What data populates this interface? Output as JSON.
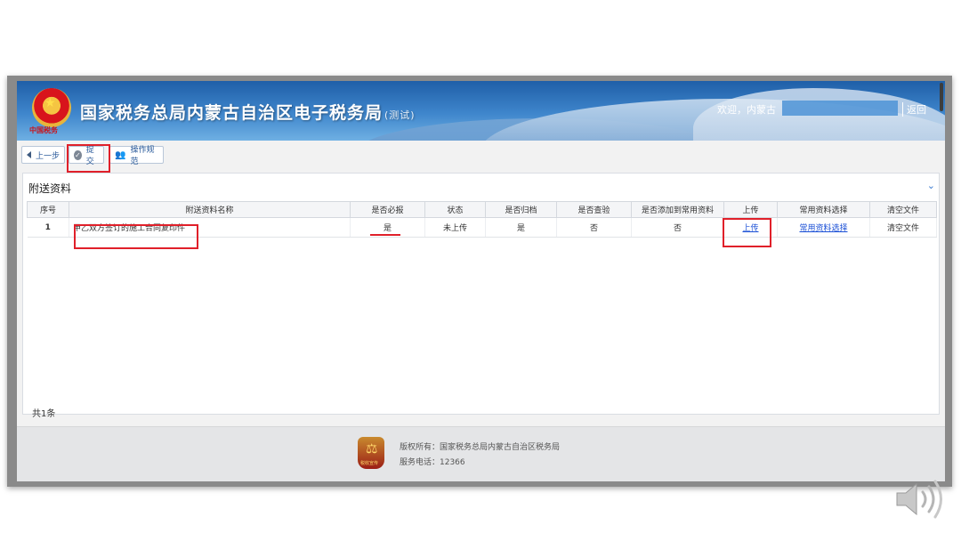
{
  "header": {
    "emblem_text": "中国税务",
    "title": "国家税务总局内蒙古自治区电子税务局",
    "title_suffix": "(测试)",
    "welcome": "欢迎，内蒙古",
    "back": "返回"
  },
  "toolbar": {
    "prev": "上一步",
    "submit": "提交",
    "rules": "操作规范"
  },
  "panel": {
    "title": "附送资料",
    "columns": [
      "序号",
      "附送资料名称",
      "是否必报",
      "状态",
      "是否归档",
      "是否查验",
      "是否添加到常用资料",
      "上传",
      "常用资料选择",
      "清空文件"
    ],
    "rows": [
      {
        "index": "1",
        "name": "甲乙双方签订的施工合同复印件",
        "required": "是",
        "status": "未上传",
        "archived": "是",
        "verified": "否",
        "add_common": "否",
        "upload": "上传",
        "common_select": "常用资料选择",
        "clear": "清空文件"
      }
    ],
    "total": "共1条"
  },
  "footer": {
    "logo_text": "税收宣传",
    "copyright": "版权所有：国家税务总局内蒙古自治区税务局",
    "phone": "服务电话：12366"
  },
  "colors": {
    "banner": "#3f86cc",
    "highlight": "#e0202a",
    "link": "#1a4fd6"
  }
}
